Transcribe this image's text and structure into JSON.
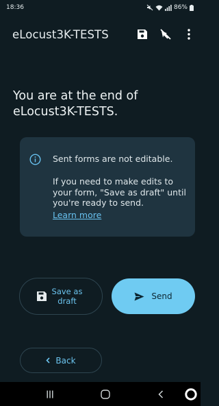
{
  "status_bar": {
    "time": "18:36",
    "battery": "86%"
  },
  "app_bar": {
    "title": "eLocust3K-TESTS",
    "icons": [
      "save-icon",
      "hide-navigation-icon",
      "more-vert-icon"
    ]
  },
  "heading": "You are at the end of eLocust3K-TESTS.",
  "info": {
    "line1": "Sent forms are not editable.",
    "line2": "If you need to make edits to your form, \"Save as draft\" until you're ready to send.",
    "link": "Learn more"
  },
  "buttons": {
    "save_draft": "Save as draft",
    "send": "Send",
    "back": "Back"
  },
  "colors": {
    "background": "#0f1c22",
    "card": "#1f3440",
    "accent": "#6fcbf2",
    "link": "#68c1ef"
  },
  "nav_bar": {
    "icons": [
      "recent-apps-icon",
      "home-icon",
      "back-nav-icon",
      "assistant-icon"
    ]
  }
}
